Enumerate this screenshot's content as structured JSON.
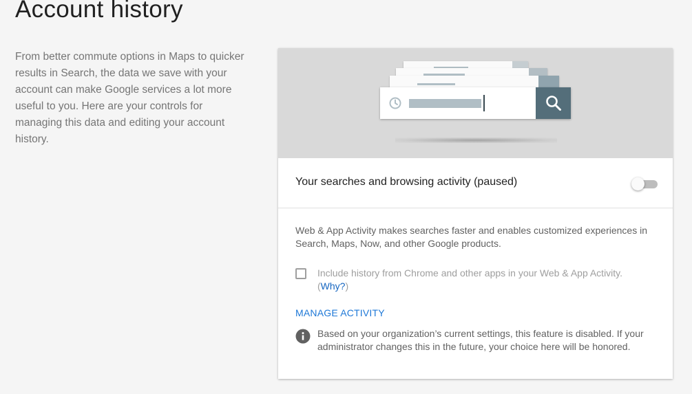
{
  "page": {
    "title": "Account history",
    "intro": "From better commute options in Maps to quicker results in Search, the data we save with your account can make Google services a lot more useful to you. Here are your controls for managing this data and editing your account history."
  },
  "card": {
    "illustration": {
      "icons": [
        "clock-icon",
        "search-icon"
      ],
      "colors": {
        "background": "#d9d9d9",
        "search_button": "#546e7a",
        "query_bar": "#b0bec5"
      }
    },
    "toggle_row": {
      "label": "Your searches and browsing activity (paused)",
      "toggle_on": false
    },
    "description": "Web & App Activity makes searches faster and enables customized experiences in Search, Maps, Now, and other Google products.",
    "checkbox": {
      "checked": false,
      "label": "Include history from Chrome and other apps in your Web & App Activity.",
      "why_open": "(",
      "why_link": "Why?",
      "why_close": ")"
    },
    "manage_activity": "MANAGE ACTIVITY",
    "notice": {
      "icon": "info-icon",
      "text": "Based on your organization’s current settings, this feature is disabled. If your administrator changes this in the future, your choice here will be honored."
    }
  },
  "colors": {
    "link": "#1e78d7",
    "text_primary": "#212121",
    "text_secondary": "#616161",
    "page_background": "#f5f5f5"
  }
}
